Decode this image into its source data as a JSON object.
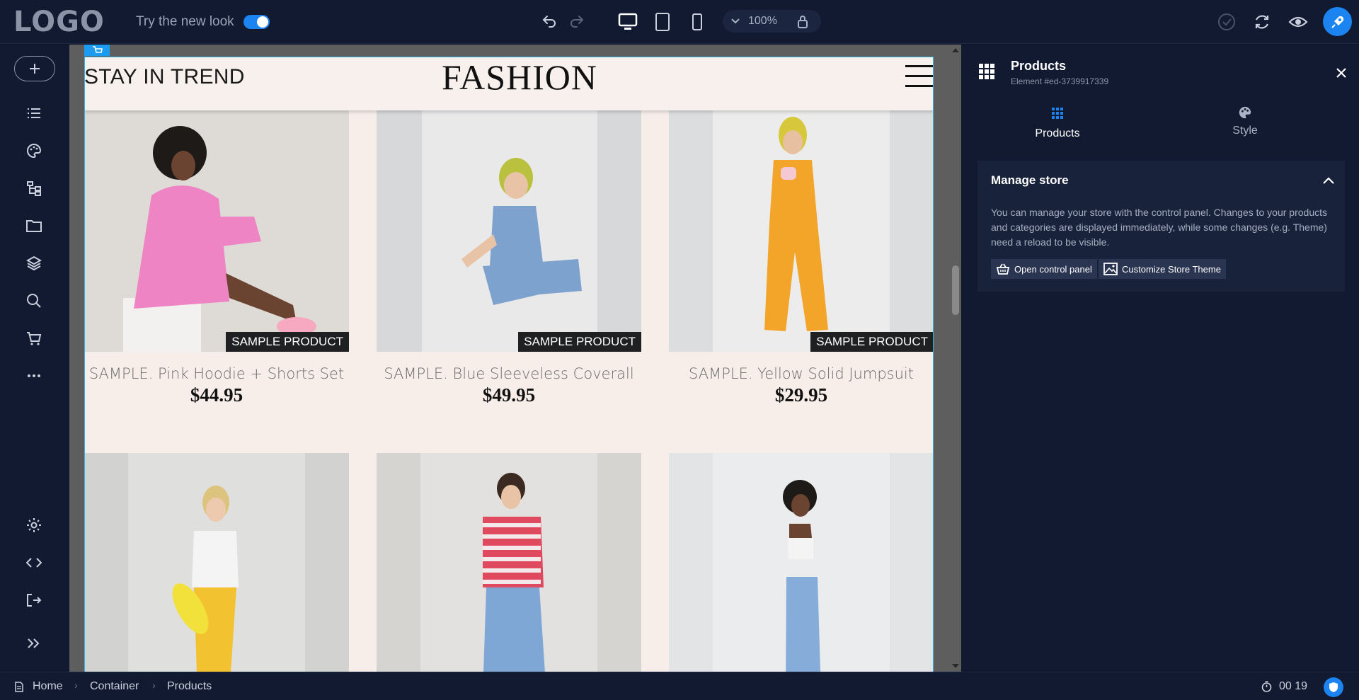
{
  "topbar": {
    "logo": "LOGO",
    "try_new_look": "Try the new look",
    "zoom": "100%"
  },
  "page": {
    "tagline": "STAY IN TREND",
    "brand": "FASHION",
    "badge": "SAMPLE PRODUCT",
    "products": [
      {
        "name": "SAMPLE. Pink Hoodie + Shorts Set",
        "price": "$44.95",
        "bg": "#d8d6d3",
        "accent": "#ec82c0"
      },
      {
        "name": "SAMPLE. Blue Sleeveless Coverall",
        "price": "$49.95",
        "bg": "#d9dadc",
        "accent": "#7da2cf"
      },
      {
        "name": "SAMPLE. Yellow Solid Jumpsuit",
        "price": "$29.95",
        "bg": "#dfe0e2",
        "accent": "#f2a328"
      },
      {
        "bg": "#d7d7d5",
        "accent": "#f2c32c"
      },
      {
        "bg": "#d6d4d1",
        "accent": "#e04a5e"
      },
      {
        "bg": "#e3e4e6",
        "accent": "#7ea7d6"
      }
    ]
  },
  "panel": {
    "title": "Products",
    "subtitle": "Element #ed-3739917339",
    "tabs": [
      {
        "label": "Products"
      },
      {
        "label": "Style"
      }
    ],
    "manage": {
      "title": "Manage store",
      "text": "You can manage your store with the control panel. Changes to your products and categories are displayed immediately, while some changes (e.g. Theme) need a reload to be visible.",
      "open_btn": "Open control panel",
      "theme_btn": "Customize Store Theme"
    }
  },
  "statusbar": {
    "crumbs": [
      "Home",
      "Container",
      "Products"
    ],
    "timer": "00 19"
  },
  "colors": {
    "accent": "#1b84f0",
    "panel_bg": "#111a30",
    "page_bg": "#f7eeea"
  }
}
